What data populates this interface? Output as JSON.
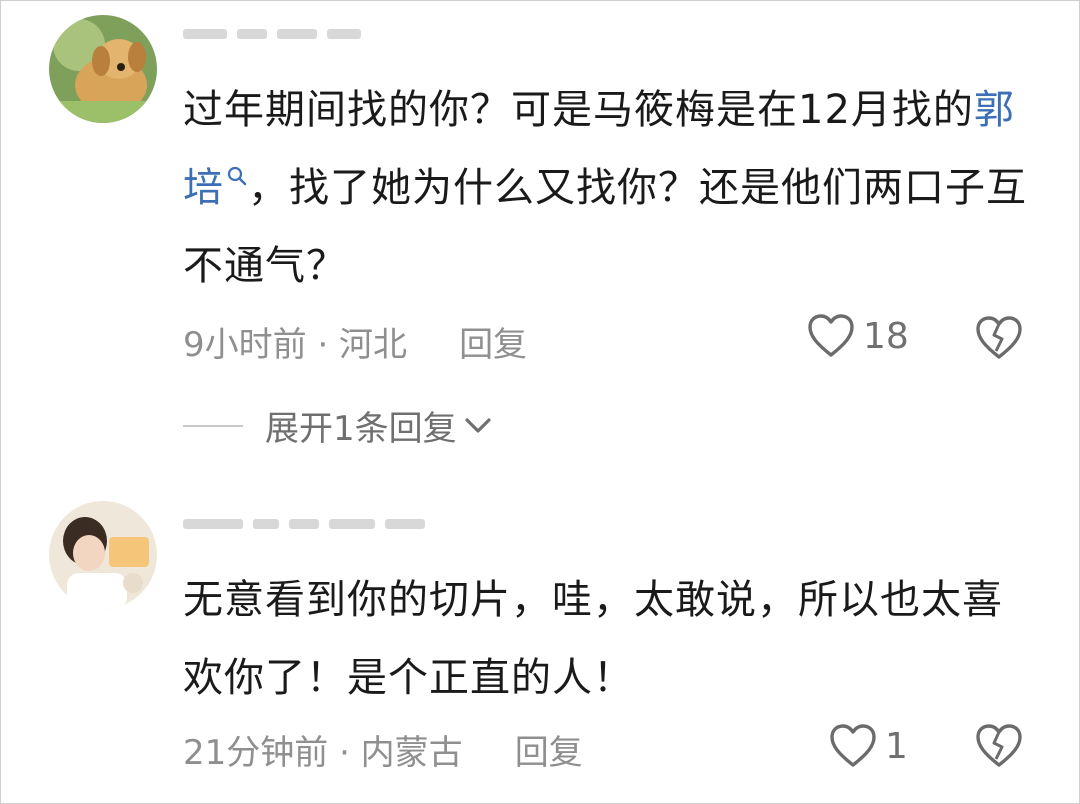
{
  "comments": [
    {
      "username_redacted": true,
      "text_before": "过年期间找的你？可是马筱梅是在12月找的",
      "link": "郭培",
      "text_after": "，找了她为什么又找你？还是他们两口子互不通气？",
      "meta": "9小时前 · 河北",
      "reply_label": "回复",
      "likes": "18",
      "expand_label": "展开1条回复"
    },
    {
      "username_redacted": true,
      "text": "无意看到你的切片，哇，太敢说，所以也太喜欢你了！是个正直的人！",
      "meta": "21分钟前 · 内蒙古",
      "reply_label": "回复",
      "likes": "1"
    }
  ],
  "icons": {
    "like": "heart-outline-icon",
    "dislike": "broken-heart-icon",
    "expand": "chevron-down-icon",
    "search": "magnifier-icon"
  },
  "colors": {
    "text": "#1a1a1a",
    "muted": "#8f8f8f",
    "link": "#3c6fb5",
    "icon": "#6b6b6b"
  }
}
